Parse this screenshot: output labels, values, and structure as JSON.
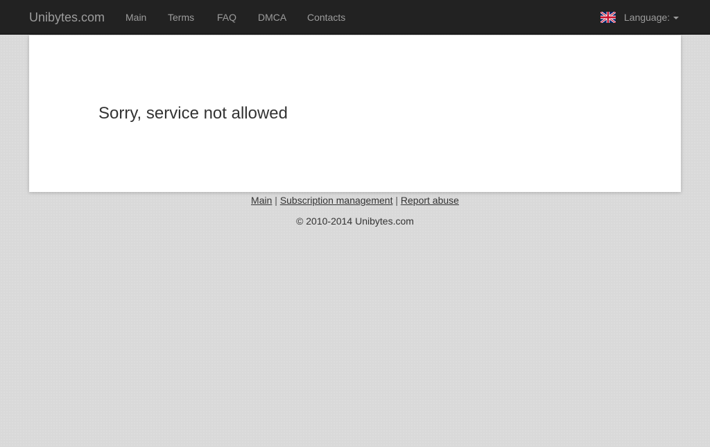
{
  "navbar": {
    "brand": "Unibytes.com",
    "links": [
      "Main",
      "Terms",
      "FAQ",
      "DMCA",
      "Contacts"
    ],
    "language_label": "Language:",
    "flag_icon": "uk-flag-icon",
    "background_color": "#222222",
    "text_color": "#9d9d9d"
  },
  "main": {
    "message": "Sorry, service not allowed"
  },
  "footer": {
    "links": [
      "Main",
      "Subscription management",
      "Report abuse"
    ],
    "separator": "|",
    "copyright": "© 2010-2014 Unibytes.com"
  },
  "colors": {
    "page_background": "#d9d9d9",
    "panel_background": "#ffffff",
    "text": "#333333"
  }
}
